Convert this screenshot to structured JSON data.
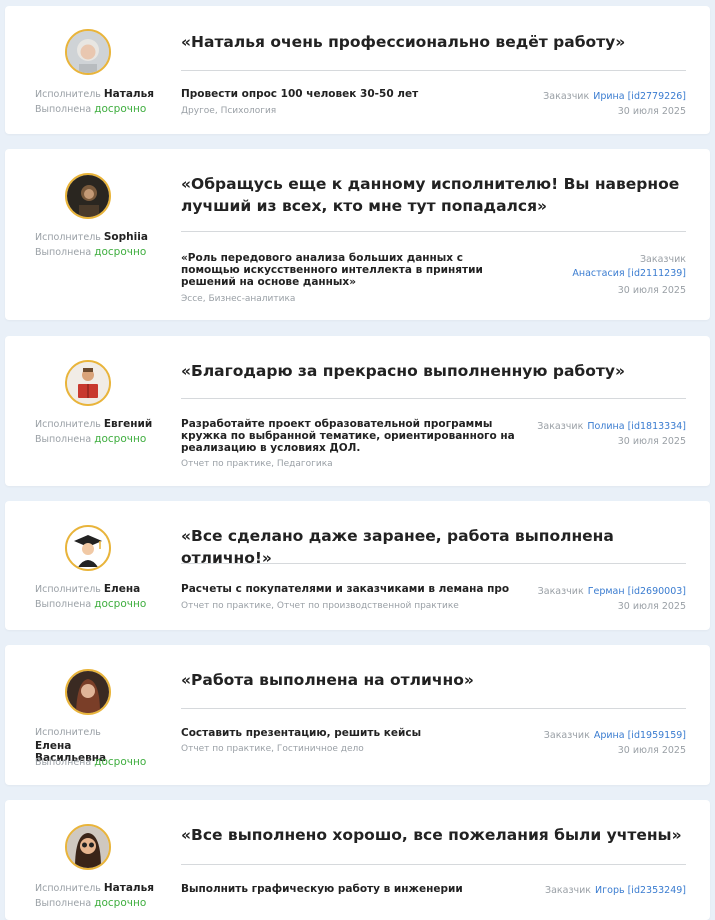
{
  "labels": {
    "executor": "Исполнитель",
    "done": "Выполнена",
    "early": "досрочно",
    "customer": "Заказчик"
  },
  "colors": {
    "accent_link": "#3a7cd0",
    "status_green": "#3fae3f",
    "avatar_ring": "#e9b43a"
  },
  "reviews": [
    {
      "executor": "Наталья",
      "quote": "«Наталья очень профессионально ведёт работу»",
      "task": "Провести опрос 100 человек 30-50 лет",
      "category": "Другое, Психология",
      "customer": "Ирина [id2779226]",
      "date": "30 июля 2025",
      "avatar": "gray-hair-woman-avatar"
    },
    {
      "executor": "Sophiia",
      "quote": "«Обращусь еще к данному исполнителю! Вы наверное лучший из всех, кто мне тут попадался»",
      "task": "«Роль передового анализа больших данных с помощью искусственного интеллекта в принятии решений на основе данных»",
      "category": "Эссе, Бизнес-аналитика",
      "customer": "Анастасия [id2111239]",
      "date": "30 июля 2025",
      "avatar": "dark-portrait-avatar"
    },
    {
      "executor": "Евгений",
      "quote": "«Благодарю за прекрасно выполненную работу»",
      "task": "Разработайте проект образовательной программы кружка по выбранной тематике, ориентированного на реализацию в условиях ДОЛ.",
      "category": "Отчет по практике, Педагогика",
      "customer": "Полина [id1813334]",
      "date": "30 июля 2025",
      "avatar": "reading-man-avatar"
    },
    {
      "executor": "Елена",
      "quote": "«Все сделано даже заранее, работа выполнена отлично!»",
      "task": "Расчеты с покупателями и заказчиками в лемана про",
      "category": "Отчет по практике, Отчет по производственной практике",
      "customer": "Герман [id2690003]",
      "date": "30 июля 2025",
      "avatar": "graduate-avatar"
    },
    {
      "executor": "Елена Васильевна",
      "quote": "«Работа выполнена на отлично»",
      "task": "Составить презентацию, решить кейсы",
      "category": "Отчет по практике, Гостиничное дело",
      "customer": "Арина [id1959159]",
      "date": "30 июля 2025",
      "avatar": "woman-photo-avatar"
    },
    {
      "executor": "Наталья",
      "quote": "«Все выполнено хорошо, все пожелания были учтены»",
      "task": "Выполнить графическую работу в инженерии",
      "category": "",
      "customer": "Игорь [id2353249]",
      "date": "",
      "avatar": "cartoon-woman-avatar"
    }
  ]
}
